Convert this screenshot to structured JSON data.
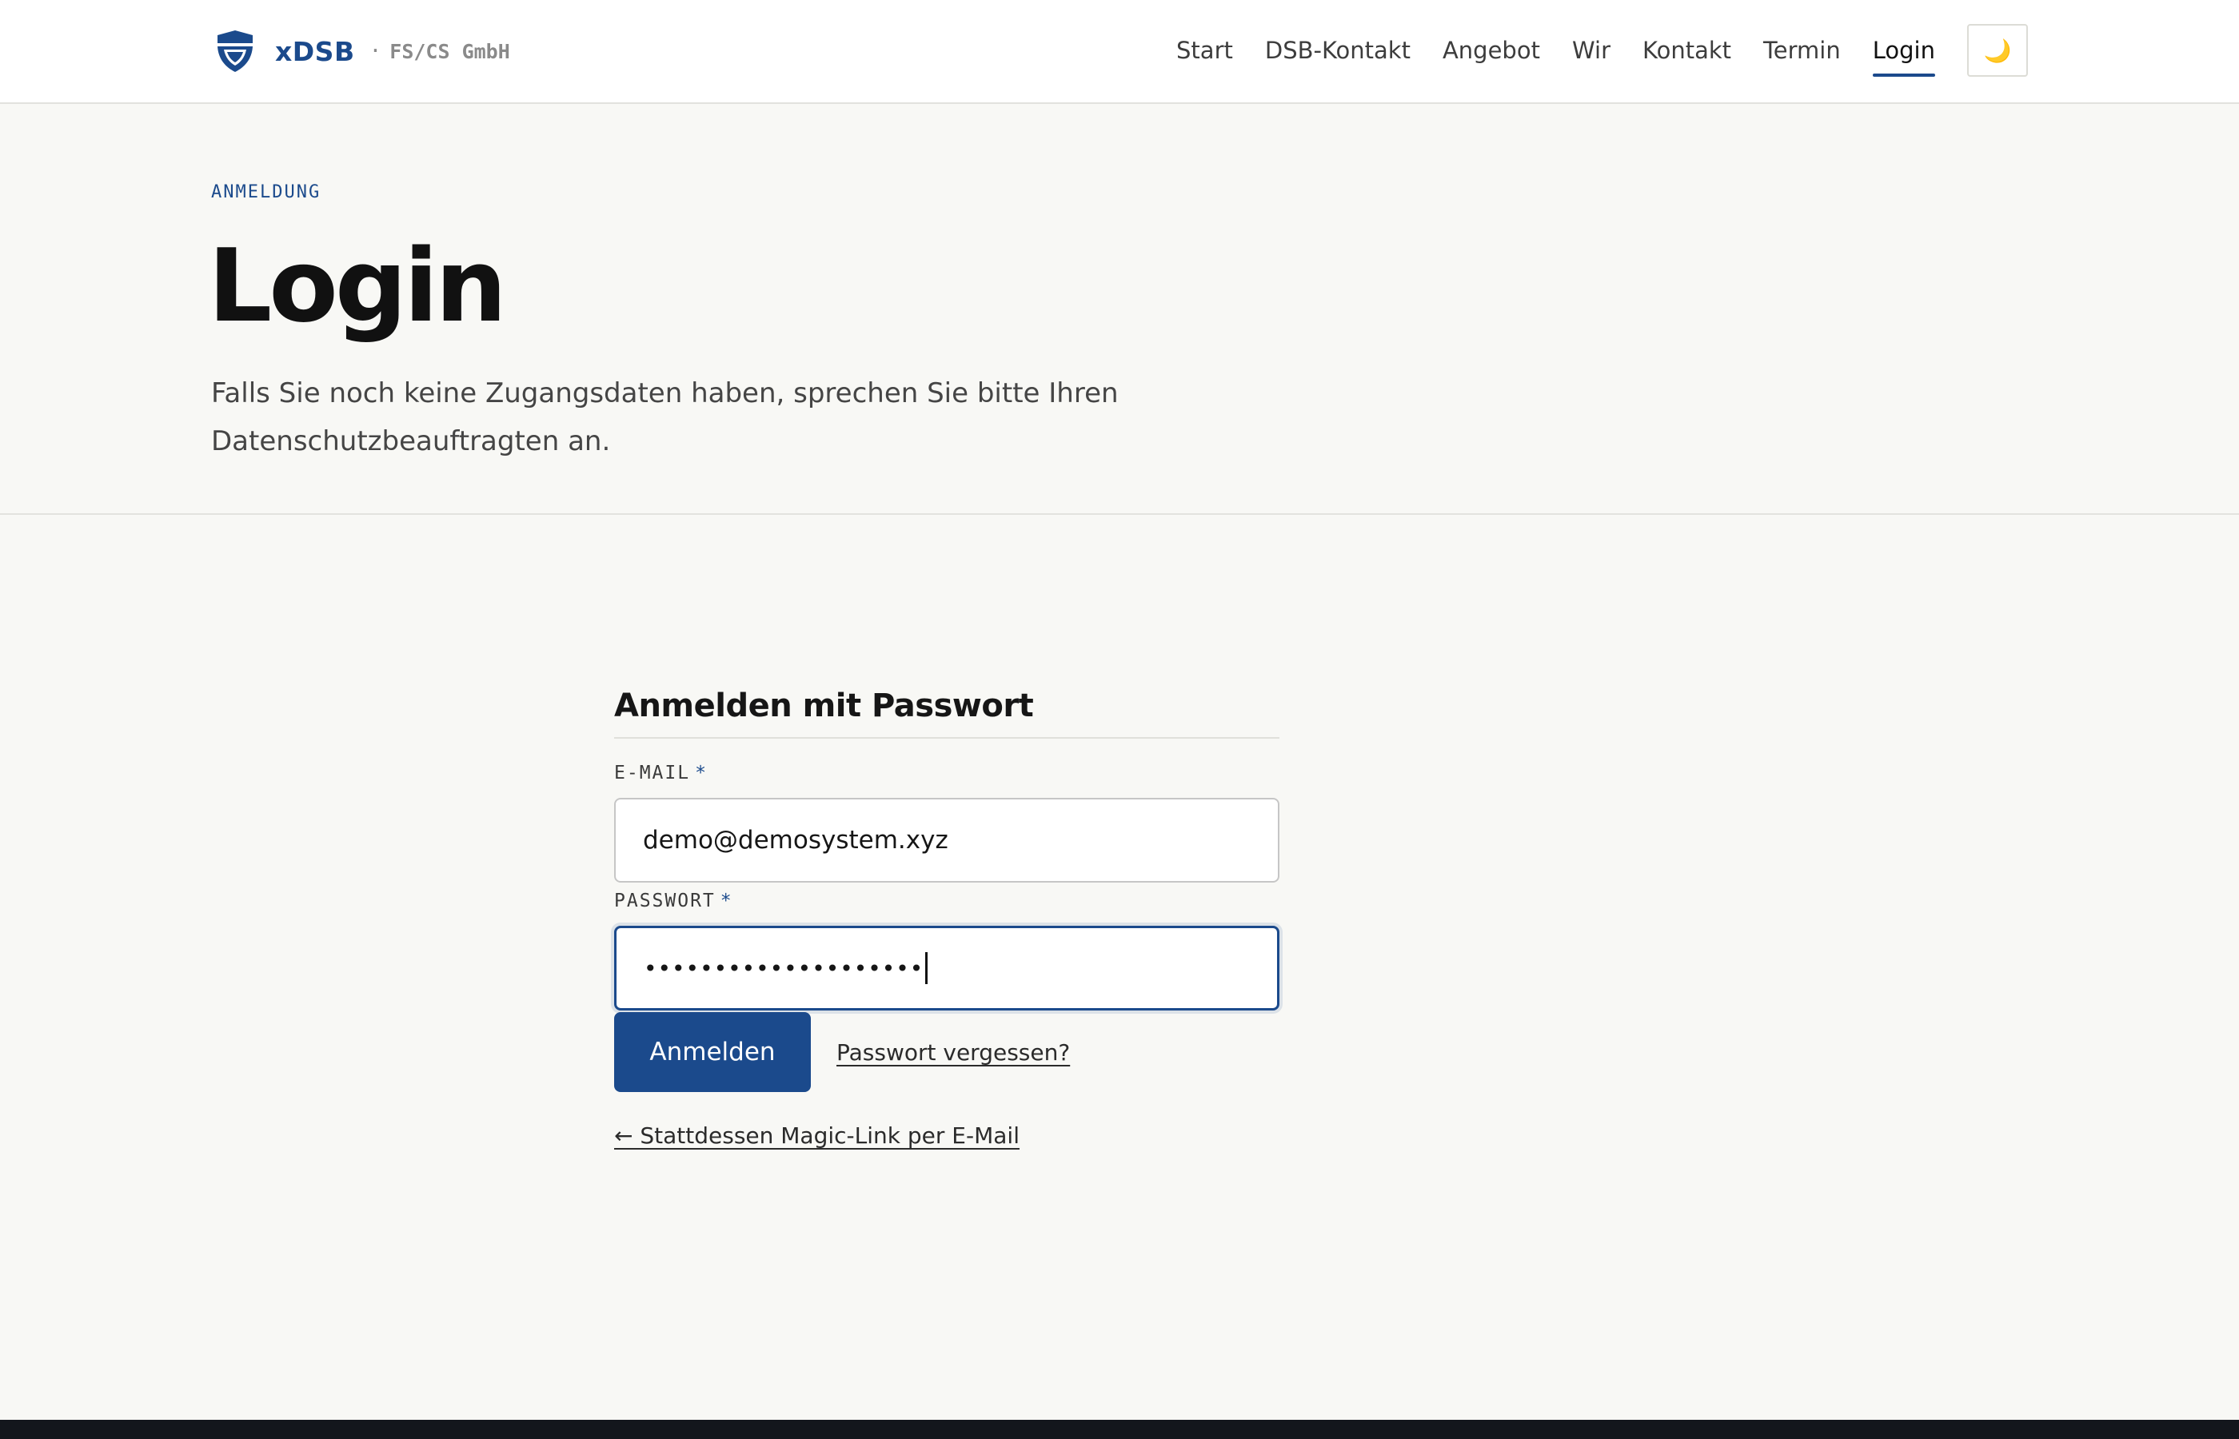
{
  "header": {
    "brand_name": "xDSB",
    "brand_separator": "·",
    "brand_company": "FS/CS GmbH",
    "nav": [
      {
        "label": "Start"
      },
      {
        "label": "DSB-Kontakt"
      },
      {
        "label": "Angebot"
      },
      {
        "label": "Wir"
      },
      {
        "label": "Kontakt"
      },
      {
        "label": "Termin"
      },
      {
        "label": "Login",
        "active": true
      }
    ],
    "theme_toggle_icon": "🌙"
  },
  "hero": {
    "eyebrow": "ANMELDUNG",
    "title": "Login",
    "lead": "Falls Sie noch keine Zugangsdaten haben, sprechen Sie bitte Ihren Datenschutzbeauftragten an."
  },
  "login_form": {
    "title": "Anmelden mit Passwort",
    "email_label": "E-MAIL",
    "required_marker": "*",
    "email_value": "demo@demosystem.xyz",
    "password_label": "PASSWORT",
    "password_masked": "••••••••••••••••••••",
    "submit_label": "Anmelden",
    "forgot_label": "Passwort vergessen?",
    "magic_link_label": "← Stattdessen Magic-Link per E-Mail"
  },
  "colors": {
    "accent": "#1b4a8c",
    "background": "#f8f8f5",
    "footer": "#13161c"
  }
}
